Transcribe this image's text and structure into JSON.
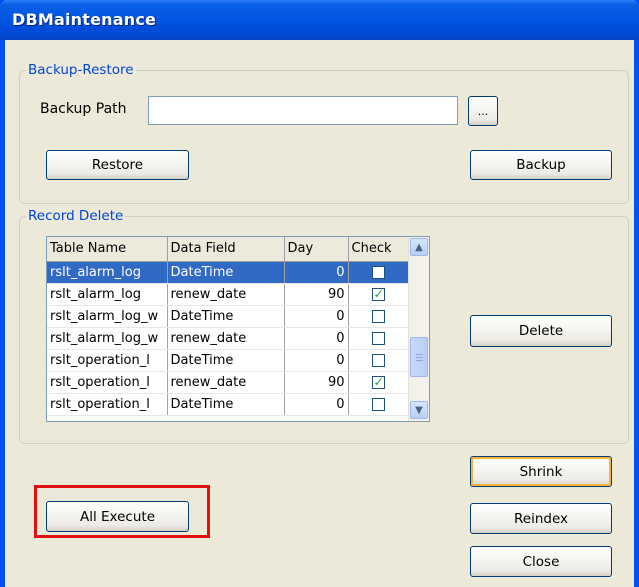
{
  "window": {
    "title": "DBMaintenance"
  },
  "backup_restore": {
    "legend": "Backup-Restore",
    "path_label": "Backup Path",
    "path_value": "",
    "browse_label": "...",
    "restore_label": "Restore",
    "backup_label": "Backup"
  },
  "record_delete": {
    "legend": "Record Delete",
    "columns": [
      "Table Name",
      "Data Field",
      "Day",
      "Check"
    ],
    "rows": [
      {
        "table": "rslt_alarm_log",
        "field": "DateTime",
        "day": "0",
        "checked": false,
        "selected": true
      },
      {
        "table": "rslt_alarm_log",
        "field": "renew_date",
        "day": "90",
        "checked": true,
        "selected": false
      },
      {
        "table": "rslt_alarm_log_w",
        "field": "DateTime",
        "day": "0",
        "checked": false,
        "selected": false
      },
      {
        "table": "rslt_alarm_log_w",
        "field": "renew_date",
        "day": "0",
        "checked": false,
        "selected": false
      },
      {
        "table": "rslt_operation_l",
        "field": "DateTime",
        "day": "0",
        "checked": false,
        "selected": false
      },
      {
        "table": "rslt_operation_l",
        "field": "renew_date",
        "day": "90",
        "checked": true,
        "selected": false
      },
      {
        "table": "rslt_operation_l",
        "field": "DateTime",
        "day": "0",
        "checked": false,
        "selected": false
      }
    ],
    "delete_label": "Delete"
  },
  "actions": {
    "all_execute_label": "All Execute",
    "shrink_label": "Shrink",
    "reindex_label": "Reindex",
    "close_label": "Close"
  },
  "icons": {
    "scroll_up": "scroll-up-arrow-icon",
    "scroll_down": "scroll-down-arrow-icon",
    "checkmark": "checkmark-icon"
  },
  "colors": {
    "titlebar": "#0053e0",
    "legend_text": "#0046d5",
    "selection": "#316ac5",
    "highlight_box": "#e01010",
    "focus_ring": "#f8b33a"
  }
}
